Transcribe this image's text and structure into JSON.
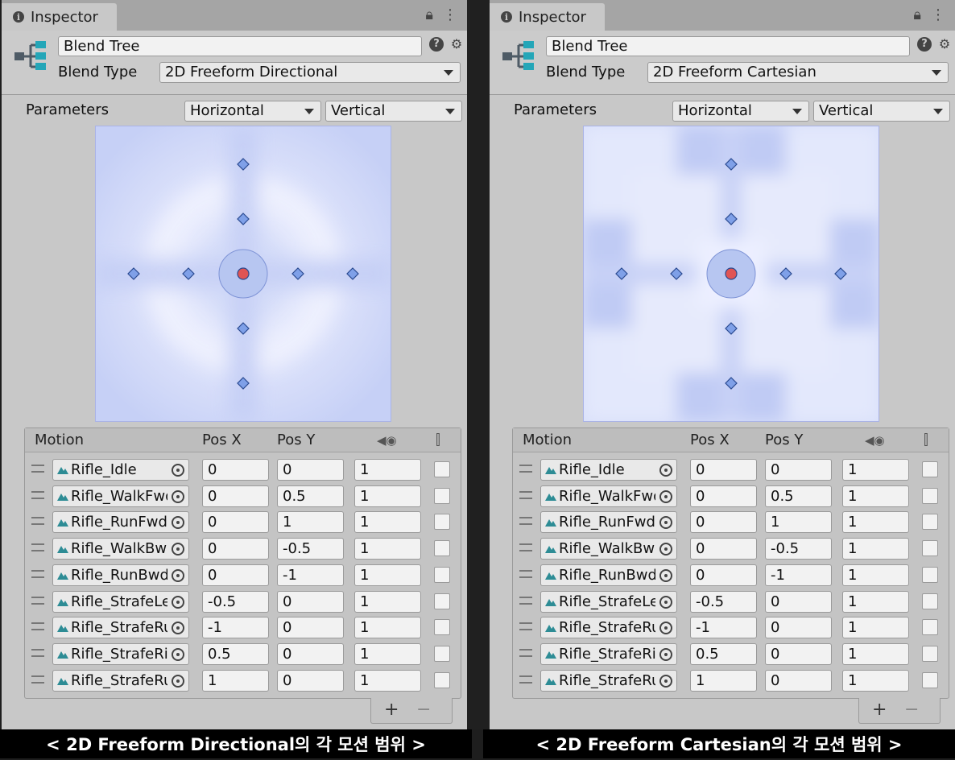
{
  "panels": [
    {
      "id": "directional",
      "tab_title": "Inspector",
      "name": "Blend Tree",
      "blend_type_label": "Blend Type",
      "blend_type": "2D Freeform Directional",
      "parameters_label": "Parameters",
      "param_x": "Horizontal",
      "param_y": "Vertical",
      "table_headers": {
        "motion": "Motion",
        "pos_x": "Pos X",
        "pos_y": "Pos Y"
      },
      "rows": [
        {
          "clip": "Rifle_Idle",
          "x": "0",
          "y": "0",
          "speed": "1"
        },
        {
          "clip": "Rifle_WalkFwd",
          "x": "0",
          "y": "0.5",
          "speed": "1"
        },
        {
          "clip": "Rifle_RunFwd",
          "x": "0",
          "y": "1",
          "speed": "1"
        },
        {
          "clip": "Rifle_WalkBwd",
          "x": "0",
          "y": "-0.5",
          "speed": "1"
        },
        {
          "clip": "Rifle_RunBwd",
          "x": "0",
          "y": "-1",
          "speed": "1"
        },
        {
          "clip": "Rifle_StrafeLeft",
          "x": "-0.5",
          "y": "0",
          "speed": "1"
        },
        {
          "clip": "Rifle_StrafeRun",
          "x": "-1",
          "y": "0",
          "speed": "1"
        },
        {
          "clip": "Rifle_StrafeRight",
          "x": "0.5",
          "y": "0",
          "speed": "1"
        },
        {
          "clip": "Rifle_StrafeRun",
          "x": "1",
          "y": "0",
          "speed": "1"
        }
      ],
      "caption": "< 2D Freeform Directional의 각 모션 범위 >"
    },
    {
      "id": "cartesian",
      "tab_title": "Inspector",
      "name": "Blend Tree",
      "blend_type_label": "Blend Type",
      "blend_type": "2D Freeform Cartesian",
      "parameters_label": "Parameters",
      "param_x": "Horizontal",
      "param_y": "Vertical",
      "table_headers": {
        "motion": "Motion",
        "pos_x": "Pos X",
        "pos_y": "Pos Y"
      },
      "rows": [
        {
          "clip": "Rifle_Idle",
          "x": "0",
          "y": "0",
          "speed": "1"
        },
        {
          "clip": "Rifle_WalkFwd",
          "x": "0",
          "y": "0.5",
          "speed": "1"
        },
        {
          "clip": "Rifle_RunFwd",
          "x": "0",
          "y": "1",
          "speed": "1"
        },
        {
          "clip": "Rifle_WalkBwd",
          "x": "0",
          "y": "-0.5",
          "speed": "1"
        },
        {
          "clip": "Rifle_RunBwd",
          "x": "0",
          "y": "-1",
          "speed": "1"
        },
        {
          "clip": "Rifle_StrafeLeft",
          "x": "-0.5",
          "y": "0",
          "speed": "1"
        },
        {
          "clip": "Rifle_StrafeRun",
          "x": "-1",
          "y": "0",
          "speed": "1"
        },
        {
          "clip": "Rifle_StrafeRight",
          "x": "0.5",
          "y": "0",
          "speed": "1"
        },
        {
          "clip": "Rifle_StrafeRun",
          "x": "1",
          "y": "0",
          "speed": "1"
        }
      ],
      "caption": "< 2D Freeform Cartesian의 각 모션 범위 >"
    }
  ],
  "icons": {
    "info": "info-icon",
    "lock": "lock-icon",
    "menu": "kebab-menu-icon",
    "blend_tree": "blend-tree-icon",
    "help": "help-icon",
    "gear": "gear-icon",
    "anim": "animation-clip-icon",
    "target": "object-picker-icon",
    "speed": "speed-icon",
    "mirror": "mirror-icon"
  },
  "colors": {
    "accent_point": "#e05454",
    "motion_point": "#7fa0e8",
    "blend_field": "#c8d2f7"
  }
}
